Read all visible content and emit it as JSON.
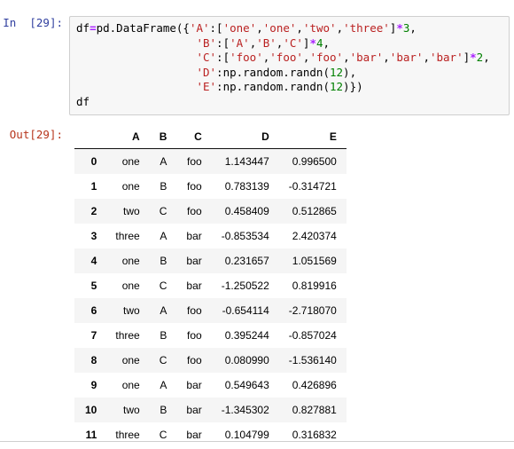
{
  "input_cell": {
    "prompt": "In  [29]:",
    "code_lines": [
      [
        {
          "t": "plain",
          "v": "df"
        },
        {
          "t": "operator",
          "v": "="
        },
        {
          "t": "plain",
          "v": "pd.DataFrame({"
        },
        {
          "t": "string",
          "v": "'A'"
        },
        {
          "t": "plain",
          "v": ":["
        },
        {
          "t": "string",
          "v": "'one'"
        },
        {
          "t": "plain",
          "v": ","
        },
        {
          "t": "string",
          "v": "'one'"
        },
        {
          "t": "plain",
          "v": ","
        },
        {
          "t": "string",
          "v": "'two'"
        },
        {
          "t": "plain",
          "v": ","
        },
        {
          "t": "string",
          "v": "'three'"
        },
        {
          "t": "plain",
          "v": "]"
        },
        {
          "t": "operator",
          "v": "*"
        },
        {
          "t": "number",
          "v": "3"
        },
        {
          "t": "plain",
          "v": ","
        }
      ],
      [
        {
          "t": "plain",
          "v": "                  "
        },
        {
          "t": "string",
          "v": "'B'"
        },
        {
          "t": "plain",
          "v": ":["
        },
        {
          "t": "string",
          "v": "'A'"
        },
        {
          "t": "plain",
          "v": ","
        },
        {
          "t": "string",
          "v": "'B'"
        },
        {
          "t": "plain",
          "v": ","
        },
        {
          "t": "string",
          "v": "'C'"
        },
        {
          "t": "plain",
          "v": "]"
        },
        {
          "t": "operator",
          "v": "*"
        },
        {
          "t": "number",
          "v": "4"
        },
        {
          "t": "plain",
          "v": ","
        }
      ],
      [
        {
          "t": "plain",
          "v": "                  "
        },
        {
          "t": "string",
          "v": "'C'"
        },
        {
          "t": "plain",
          "v": ":["
        },
        {
          "t": "string",
          "v": "'foo'"
        },
        {
          "t": "plain",
          "v": ","
        },
        {
          "t": "string",
          "v": "'foo'"
        },
        {
          "t": "plain",
          "v": ","
        },
        {
          "t": "string",
          "v": "'foo'"
        },
        {
          "t": "plain",
          "v": ","
        },
        {
          "t": "string",
          "v": "'bar'"
        },
        {
          "t": "plain",
          "v": ","
        },
        {
          "t": "string",
          "v": "'bar'"
        },
        {
          "t": "plain",
          "v": ","
        },
        {
          "t": "string",
          "v": "'bar'"
        },
        {
          "t": "plain",
          "v": "]"
        },
        {
          "t": "operator",
          "v": "*"
        },
        {
          "t": "number",
          "v": "2"
        },
        {
          "t": "plain",
          "v": ","
        }
      ],
      [
        {
          "t": "plain",
          "v": "                  "
        },
        {
          "t": "string",
          "v": "'D'"
        },
        {
          "t": "plain",
          "v": ":np.random.randn("
        },
        {
          "t": "number",
          "v": "12"
        },
        {
          "t": "plain",
          "v": "),"
        }
      ],
      [
        {
          "t": "plain",
          "v": "                  "
        },
        {
          "t": "string",
          "v": "'E'"
        },
        {
          "t": "plain",
          "v": ":np.random.randn("
        },
        {
          "t": "number",
          "v": "12"
        },
        {
          "t": "plain",
          "v": ")})"
        }
      ],
      [
        {
          "t": "plain",
          "v": "df"
        }
      ]
    ]
  },
  "output_cell": {
    "prompt": "Out[29]:",
    "table": {
      "index_header": "",
      "columns": [
        "A",
        "B",
        "C",
        "D",
        "E"
      ],
      "rows": [
        {
          "index": "0",
          "cells": [
            "one",
            "A",
            "foo",
            "1.143447",
            "0.996500"
          ]
        },
        {
          "index": "1",
          "cells": [
            "one",
            "B",
            "foo",
            "0.783139",
            "-0.314721"
          ]
        },
        {
          "index": "2",
          "cells": [
            "two",
            "C",
            "foo",
            "0.458409",
            "0.512865"
          ]
        },
        {
          "index": "3",
          "cells": [
            "three",
            "A",
            "bar",
            "-0.853534",
            "2.420374"
          ]
        },
        {
          "index": "4",
          "cells": [
            "one",
            "B",
            "bar",
            "0.231657",
            "1.051569"
          ]
        },
        {
          "index": "5",
          "cells": [
            "one",
            "C",
            "bar",
            "-1.250522",
            "0.819916"
          ]
        },
        {
          "index": "6",
          "cells": [
            "two",
            "A",
            "foo",
            "-0.654114",
            "-2.718070"
          ]
        },
        {
          "index": "7",
          "cells": [
            "three",
            "B",
            "foo",
            "0.395244",
            "-0.857024"
          ]
        },
        {
          "index": "8",
          "cells": [
            "one",
            "C",
            "foo",
            "0.080990",
            "-1.536140"
          ]
        },
        {
          "index": "9",
          "cells": [
            "one",
            "A",
            "bar",
            "0.549643",
            "0.426896"
          ]
        },
        {
          "index": "10",
          "cells": [
            "two",
            "B",
            "bar",
            "-1.345302",
            "0.827881"
          ]
        },
        {
          "index": "11",
          "cells": [
            "three",
            "C",
            "bar",
            "0.104799",
            "0.316832"
          ]
        }
      ]
    }
  },
  "colors": {
    "prompt_in": "#303f9f",
    "prompt_out": "#b7351c",
    "string": "#ba2121",
    "number": "#008000",
    "operator": "#aa22ff",
    "cell_background": "#f7f7f7",
    "cell_border": "#cfcfcf",
    "row_stripe": "#f5f5f5"
  }
}
